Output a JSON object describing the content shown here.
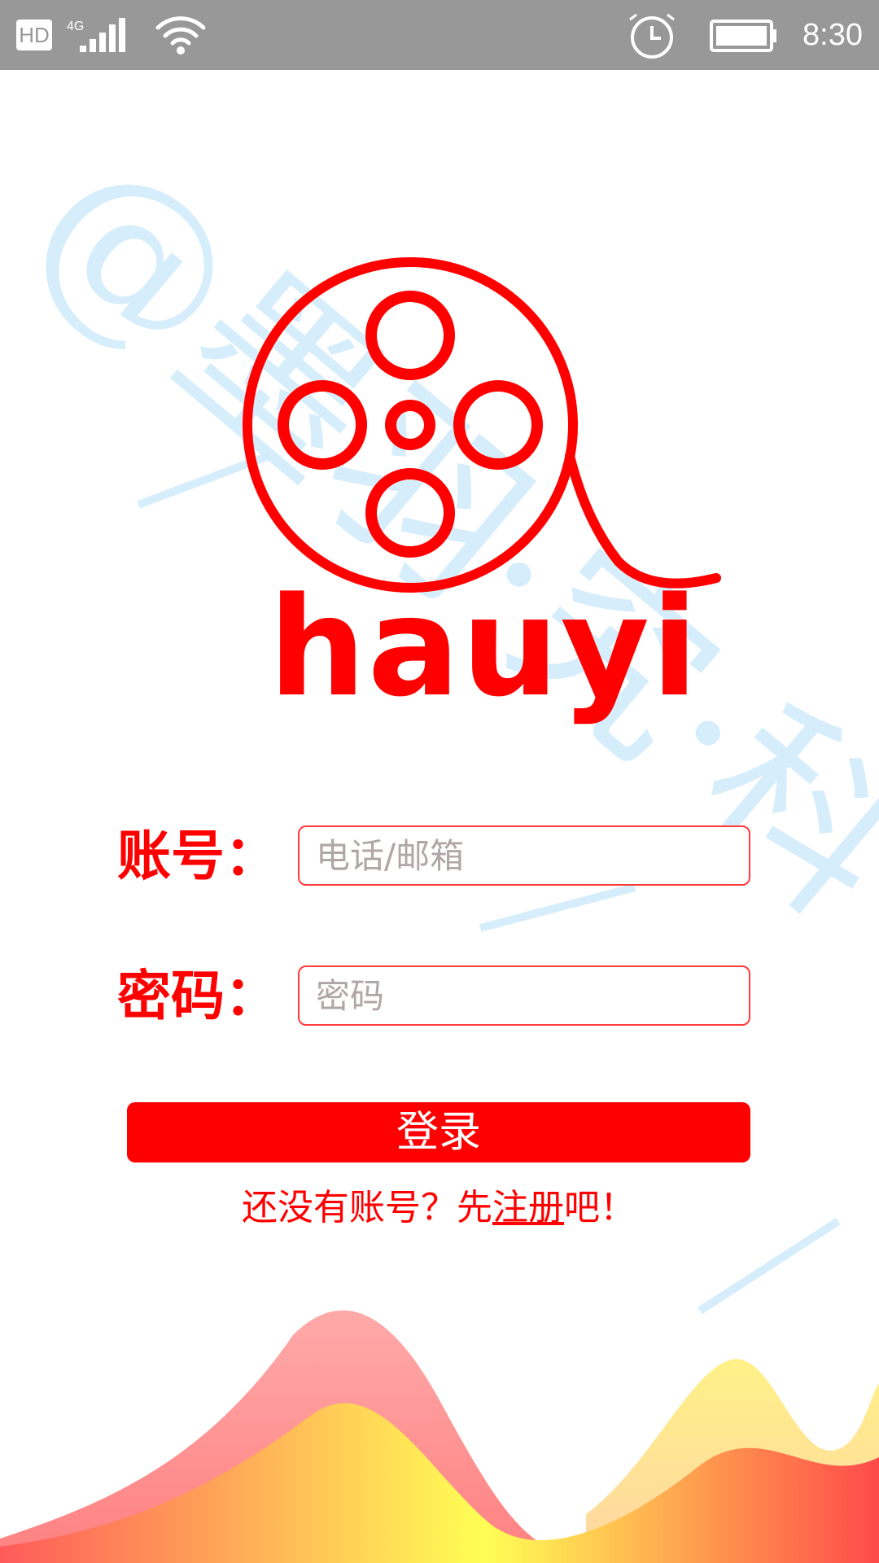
{
  "status_bar": {
    "hd_badge": "HD",
    "network": "4G",
    "time": "8:30",
    "icons": [
      "signal-icon",
      "wifi-icon",
      "alarm-clock-icon",
      "battery-icon"
    ]
  },
  "watermark": {
    "text": "@墨羽·究·科·旧"
  },
  "brand": {
    "name": "hauyi",
    "color": "#ff0000",
    "logo_icon": "film-reel-icon"
  },
  "form": {
    "account_label": "账号：",
    "account_placeholder": "电话/邮箱",
    "password_label": "密码：",
    "password_placeholder": "密码"
  },
  "login_button": {
    "label": "登录"
  },
  "register": {
    "prefix": "还没有账号？先",
    "link": "注册",
    "suffix": "吧！"
  },
  "colors": {
    "status_bar": "#989898",
    "accent": "#ff0000",
    "wave_pink": "#ff8a8a",
    "wave_yellow": "#ffff55"
  }
}
